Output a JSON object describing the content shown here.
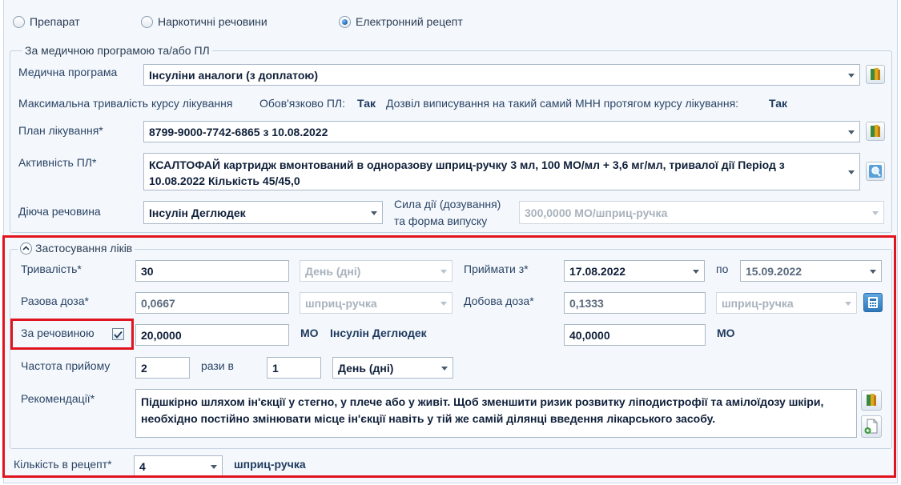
{
  "radios": [
    {
      "label": "Препарат",
      "checked": false
    },
    {
      "label": "Наркотичні речовини",
      "checked": false
    },
    {
      "label": "Електронний рецепт",
      "checked": true
    }
  ],
  "program_group": {
    "title": "За медичною програмою та/або ПЛ",
    "medical_program_label": "Медична програма",
    "medical_program_value": "Інсуліни аналоги (з доплатою)",
    "max_duration_label": "Максимальна тривалість курсу лікування",
    "mandatory_pl_label": "Обов'язково ПЛ:",
    "mandatory_pl_value": "Так",
    "same_mnn_label": "Дозвіл виписування на такий самий МНН протягом курсу лікування:",
    "same_mnn_value": "Так",
    "plan_label": "План лікування*",
    "plan_value": "8799-9000-7742-6865 з 10.08.2022",
    "activity_label": "Активність ПЛ*",
    "activity_value": "КСАЛТОФАЙ картридж вмонтований в одноразову шприц-ручку 3 мл, 100 МО/мл + 3,6 мг/мл, тривалої дії Період з 10.08.2022 Кількість 45/45,0",
    "substance_label": "Діюча речовина",
    "substance_value": "Інсулін Деглюдек",
    "strength_label_1": "Сила дії (дозування)",
    "strength_label_2": "та форма випуску",
    "strength_value": "300,0000 МО/шприц-ручка"
  },
  "usage_group": {
    "title": "Застосування ліків",
    "duration_label": "Тривалість*",
    "duration_value": "30",
    "duration_unit": "День (дні)",
    "take_from_label": "Приймати з*",
    "take_from_value": "17.08.2022",
    "to_label": "по",
    "to_value": "15.09.2022",
    "single_dose_label": "Разова доза*",
    "single_dose_value": "0,0667",
    "single_dose_unit": "шприц-ручка",
    "daily_dose_label": "Добова доза*",
    "daily_dose_value": "0,1333",
    "daily_dose_unit": "шприц-ручка",
    "by_substance_label": "За речовиною",
    "by_substance_checked": true,
    "substance_single_value": "20,0000",
    "substance_unit": "МО",
    "substance_name": "Інсулін Деглюдек",
    "substance_daily_value": "40,0000",
    "substance_daily_unit": "МО",
    "frequency_label": "Частота прийому",
    "frequency_value": "2",
    "times_in_label": "рази в",
    "period_value": "1",
    "period_unit": "День (дні)",
    "recommendations_label": "Рекомендації*",
    "recommendations_value": "Підшкірно шляхом ін'єкції у стегно, у плече або у живіт. Щоб зменшити ризик розвитку ліподистрофії та амілоїдозу шкіри, необхідно постійно змінювати місце ін'єкції навіть у тій же самій ділянці введення лікарського засобу."
  },
  "quantity": {
    "label": "Кількість в рецепт*",
    "value": "4",
    "unit": "шприц-ручка"
  },
  "colors": {
    "highlight": "#e0141e",
    "background": "#f4f8fc",
    "label_text": "#2b4466"
  }
}
